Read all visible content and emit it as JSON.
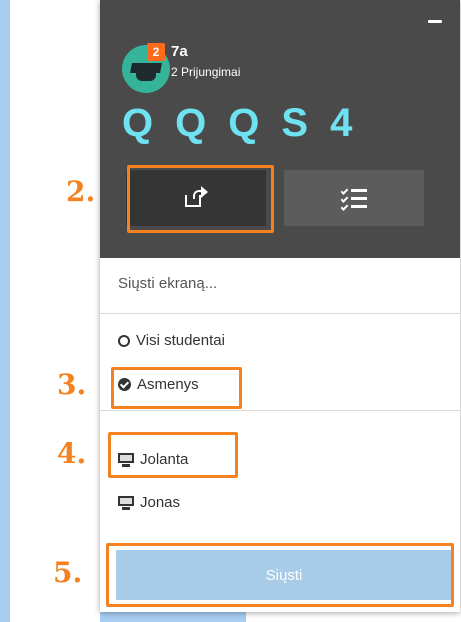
{
  "class_panel": {
    "badge_count": "2",
    "class_name": "7a",
    "connections": "2 Prijungimai",
    "codes": [
      "Q",
      "Q",
      "Q",
      "S",
      "4"
    ]
  },
  "send_section": {
    "title": "Siųsti ekraną...",
    "audience_options": [
      {
        "label": "Visi studentai",
        "selected": false
      },
      {
        "label": "Asmenys",
        "selected": true
      }
    ],
    "students": [
      "Jolanta",
      "Jonas"
    ],
    "send_label": "Siųsti"
  },
  "steps": [
    "2.",
    "3.",
    "4.",
    "5."
  ],
  "colors": {
    "header_bg": "#4a4a4a",
    "code_color": "#6fe2f2",
    "highlight": "#f58220",
    "send_button_bg": "#a8cbe8",
    "badge_bg": "#ff6b1a",
    "avatar_bg": "#35b49a"
  },
  "icons": {
    "share": "share-screen-icon",
    "list": "checklist-icon",
    "minimize": "minimize-icon",
    "student": "monitor-icon",
    "avatar": "graduation-cap-icon"
  }
}
